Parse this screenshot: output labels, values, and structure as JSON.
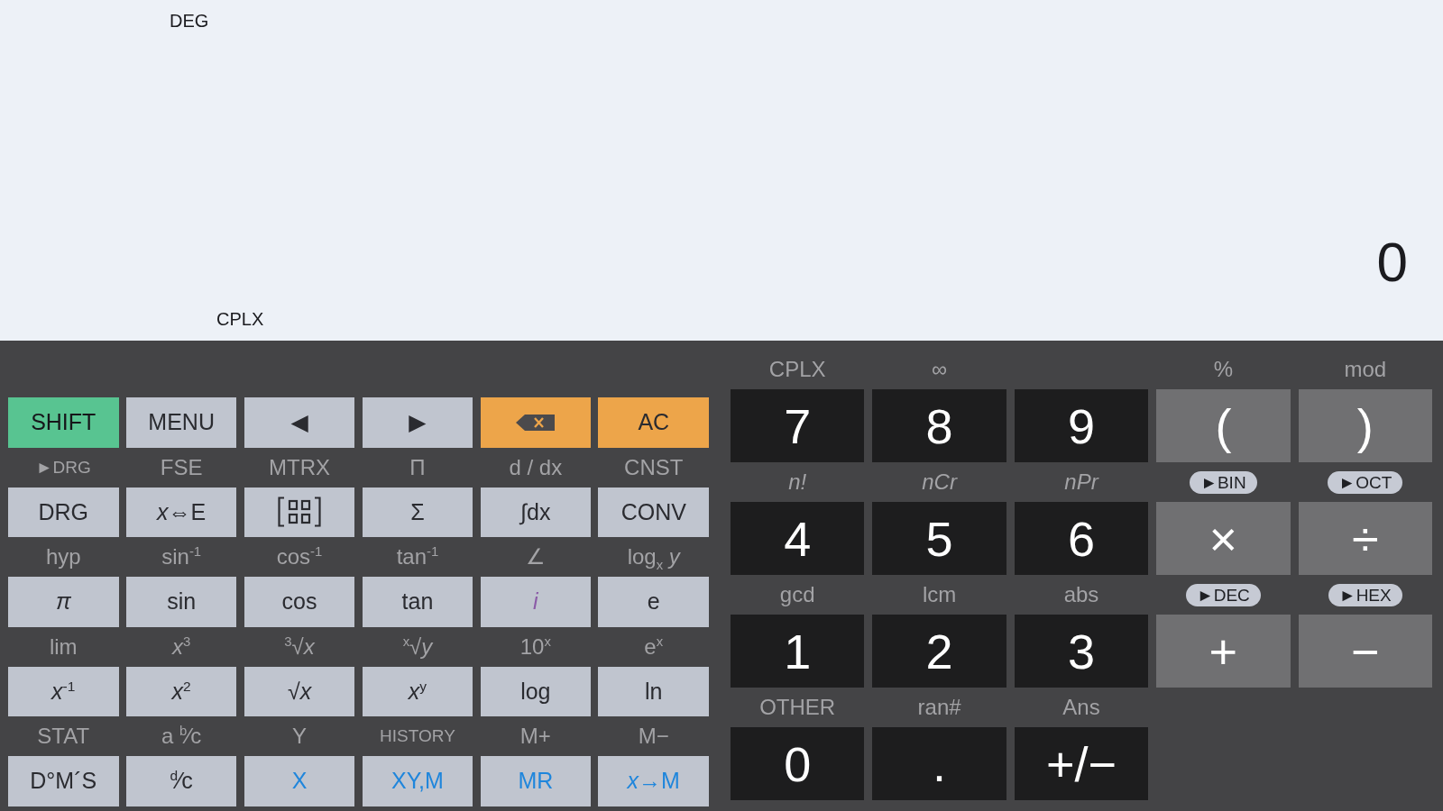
{
  "display": {
    "angle_mode": "DEG",
    "result": "0",
    "complex_mode": "CPLX"
  },
  "function_pad": [
    [
      {
        "label": "SHIFT",
        "kind": "shift"
      },
      {
        "label": "MENU",
        "kind": "menu"
      },
      {
        "label": "◀",
        "kind": "cursor"
      },
      {
        "label": "▶",
        "kind": "cursor"
      },
      {
        "kind": "backspace"
      },
      {
        "label": "AC",
        "kind": "action"
      }
    ],
    [
      {
        "alt": {
          "text": "►DRG",
          "kind": "small"
        },
        "label": "DRG",
        "kind": "plain"
      },
      {
        "alt": {
          "text": "FSE",
          "kind": "plain"
        },
        "label": "*x*⇔E",
        "kind": "plain"
      },
      {
        "alt": {
          "text": "MTRX",
          "kind": "plain"
        },
        "kind": "matrix"
      },
      {
        "alt": {
          "text": "Π",
          "kind": "plain"
        },
        "label": "Σ",
        "kind": "plain"
      },
      {
        "alt": {
          "text": "d / dx",
          "kind": "plain"
        },
        "label": "∫dx",
        "kind": "plain"
      },
      {
        "alt": {
          "text": "CNST",
          "kind": "plain"
        },
        "label": "CONV",
        "kind": "plain"
      }
    ],
    [
      {
        "alt": {
          "text": "hyp",
          "kind": "plain"
        },
        "label": "π",
        "kind": "italic"
      },
      {
        "alt": {
          "text": "sin$^{-1}$",
          "kind": "plain"
        },
        "label": "sin",
        "kind": "plain"
      },
      {
        "alt": {
          "text": "cos$^{-1}$",
          "kind": "plain"
        },
        "label": "cos",
        "kind": "plain"
      },
      {
        "alt": {
          "text": "tan$^{-1}$",
          "kind": "plain"
        },
        "label": "tan",
        "kind": "plain"
      },
      {
        "alt": {
          "text": "∠",
          "kind": "plain"
        },
        "label": "i",
        "kind": "imaginary"
      },
      {
        "alt": {
          "text": "log$_{x}$ *y*",
          "kind": "plain"
        },
        "label": "e",
        "kind": "plain"
      }
    ],
    [
      {
        "alt": {
          "text": "lim",
          "kind": "plain"
        },
        "label": "*x*$^{-1}$",
        "kind": "plain"
      },
      {
        "alt": {
          "text": "*x*$^{3}$",
          "kind": "plain"
        },
        "label": "*x*$^{2}$",
        "kind": "plain"
      },
      {
        "alt": {
          "text": "$^{3}$√*x*",
          "kind": "plain"
        },
        "label": "√*x*",
        "kind": "plain"
      },
      {
        "alt": {
          "text": "$^{x}$√*y*",
          "kind": "plain"
        },
        "label": "*x*$^{y}$",
        "kind": "plain"
      },
      {
        "alt": {
          "text": "10$^{x}$",
          "kind": "plain"
        },
        "label": "log",
        "kind": "plain"
      },
      {
        "alt": {
          "text": "e$^{x}$",
          "kind": "plain"
        },
        "label": "ln",
        "kind": "plain"
      }
    ],
    [
      {
        "alt": {
          "text": "STAT",
          "kind": "plain"
        },
        "label": "D°M´S",
        "kind": "plain"
      },
      {
        "alt": {
          "text": "a $^{b}$⁄c",
          "kind": "plain"
        },
        "label": "$^{d}$⁄c",
        "kind": "plain"
      },
      {
        "alt": {
          "text": "Y",
          "kind": "plain"
        },
        "label": "X",
        "kind": "memory"
      },
      {
        "alt": {
          "text": "HISTORY",
          "kind": "small"
        },
        "label": "XY,M",
        "kind": "memory"
      },
      {
        "alt": {
          "text": "M+",
          "kind": "plain"
        },
        "label": "MR",
        "kind": "memory"
      },
      {
        "alt": {
          "text": "M−",
          "kind": "plain"
        },
        "label": "*x*→M",
        "kind": "memory"
      }
    ]
  ],
  "number_pad": [
    [
      {
        "alt": {
          "text": "CPLX",
          "kind": "plain"
        },
        "label": "7",
        "kind": "digit"
      },
      {
        "alt": {
          "text": "∞",
          "kind": "plain"
        },
        "label": "8",
        "kind": "digit"
      },
      {
        "label": "9",
        "kind": "digit"
      },
      {
        "alt": {
          "text": "%",
          "kind": "plain"
        },
        "label": "(",
        "kind": "operator"
      },
      {
        "alt": {
          "text": "mod",
          "kind": "plain"
        },
        "label": ")",
        "kind": "operator"
      }
    ],
    [
      {
        "alt": {
          "text": "n!",
          "kind": "italic"
        },
        "label": "4",
        "kind": "digit"
      },
      {
        "alt": {
          "text": "nCr",
          "kind": "italic"
        },
        "label": "5",
        "kind": "digit"
      },
      {
        "alt": {
          "text": "nPr",
          "kind": "italic"
        },
        "label": "6",
        "kind": "digit"
      },
      {
        "alt": {
          "text": "►BIN",
          "kind": "pill"
        },
        "label": "×",
        "kind": "operator"
      },
      {
        "alt": {
          "text": "►OCT",
          "kind": "pill"
        },
        "label": "÷",
        "kind": "operator"
      }
    ],
    [
      {
        "alt": {
          "text": "gcd",
          "kind": "plain"
        },
        "label": "1",
        "kind": "digit"
      },
      {
        "alt": {
          "text": "lcm",
          "kind": "plain"
        },
        "label": "2",
        "kind": "digit"
      },
      {
        "alt": {
          "text": "abs",
          "kind": "plain"
        },
        "label": "3",
        "kind": "digit"
      },
      {
        "alt": {
          "text": "►DEC",
          "kind": "pill"
        },
        "label": "+",
        "kind": "operator"
      },
      {
        "alt": {
          "text": "►HEX",
          "kind": "pill"
        },
        "label": "−",
        "kind": "operator"
      }
    ],
    [
      {
        "alt": {
          "text": "OTHER",
          "kind": "plain"
        },
        "label": "0",
        "kind": "digit"
      },
      {
        "alt": {
          "text": "ran#",
          "kind": "plain"
        },
        "label": ".",
        "kind": "point"
      },
      {
        "alt": {
          "text": "Ans",
          "kind": "plain"
        },
        "label": "+/−",
        "kind": "sign"
      }
    ]
  ]
}
